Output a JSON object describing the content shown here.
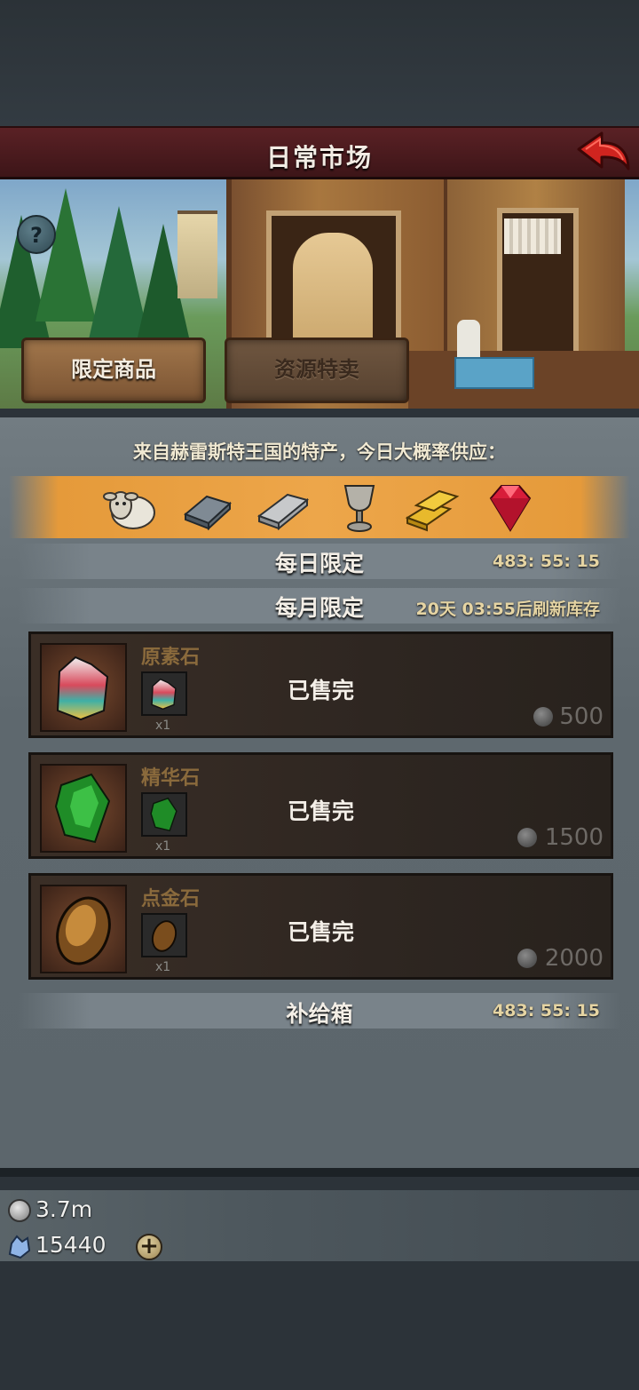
{
  "header": {
    "title": "日常市场",
    "back_icon": "red-back-arrow-icon"
  },
  "banner": {
    "help_label": "?",
    "tabs": [
      {
        "label": "限定商品",
        "active": true
      },
      {
        "label": "资源特卖",
        "active": false
      }
    ]
  },
  "notice": "来自赫雷斯特王国的特产，今日大概率供应：",
  "goods": [
    "sheep-icon",
    "iron-ingot-icon",
    "silver-bar-icon",
    "goblet-icon",
    "gold-bars-icon",
    "ruby-icon"
  ],
  "sections": {
    "daily": {
      "title": "每日限定",
      "timer": "483: 55: 15"
    },
    "monthly": {
      "title": "每月限定",
      "timer": "20天 03:55后刷新库存"
    },
    "supply": {
      "title": "补给箱",
      "timer": "483: 55: 15"
    }
  },
  "items": [
    {
      "name": "原素石",
      "qty": "x1",
      "status": "已售完",
      "price": "500",
      "icon": "element-stone-icon"
    },
    {
      "name": "精华石",
      "qty": "x1",
      "status": "已售完",
      "price": "1500",
      "icon": "essence-stone-icon"
    },
    {
      "name": "点金石",
      "qty": "x1",
      "status": "已售完",
      "price": "2000",
      "icon": "gold-touch-stone-icon"
    }
  ],
  "resources": {
    "silver": "3.7m",
    "crystal": "15440",
    "add_label": "+"
  },
  "colors": {
    "header_red": "#5a2125",
    "goods_strip_orange": "#eda64a",
    "panel_gray": "#6a747a"
  }
}
